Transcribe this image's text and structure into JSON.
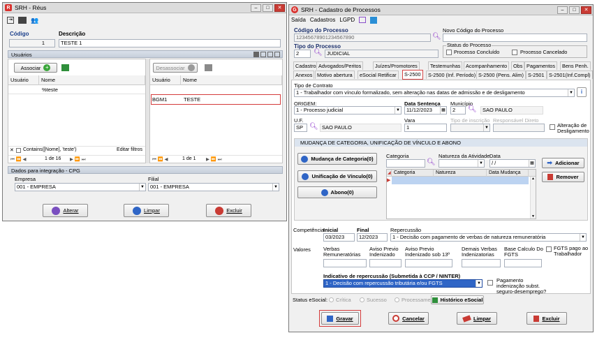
{
  "colors": {
    "accent_blue": "#2f65c6",
    "selected_row": "#3b7dd8",
    "highlight_red": "#d43b3b",
    "header_blue": "#dbe8f7"
  },
  "left": {
    "title": "SRH - Réus",
    "codigo_label": "Código",
    "descricao_label": "Descrição",
    "codigo_value": "1",
    "descricao_value": "TESTE 1",
    "usuarios_header": "Usuários",
    "associar": "Associar",
    "desassociar": "Desassociar",
    "col_usuario": "Usuário",
    "col_nome": "Nome",
    "filter_nome": "%teste",
    "right_row": {
      "usuario": "BGM1",
      "nome": "TESTE"
    },
    "filter_text": "Contains([Nome], 'teste')",
    "editar_filtros": "Editar filtros",
    "pager_left": "1 de 16",
    "pager_right": "1 de 1",
    "integracao_header": "Dados para integração - CPG",
    "empresa_label": "Empresa",
    "empresa_value": "001 - EMPRESA",
    "filial_label": "Filial",
    "filial_value": "001 - EMPRESA",
    "alterar": "Alterar",
    "limpar": "Limpar",
    "excluir": "Excluir"
  },
  "right": {
    "title": "SRH - Cadastro de Processos",
    "menu": [
      "Saída",
      "Cadastros",
      "LGPD"
    ],
    "codigo_processo_label": "Código do Processo",
    "codigo_processo_value": "12345678901234567890",
    "novo_codigo_label": "Novo Código do Processo",
    "tipo_processo_label": "Tipo do Processo",
    "tipo_code": "2",
    "tipo_desc": "JUDICIAL",
    "status_label": "Status do Processo",
    "status_opts": [
      "Processo Concluído",
      "Processo Cancelado"
    ],
    "tabs_row1": [
      "Cadastros",
      "Advogados/Peritos",
      "Juízes/Promotores",
      "Testemunhas",
      "Acompanhamento",
      "Obs",
      "Pagamentos",
      "Bens Penh."
    ],
    "tabs_row2": [
      "Anexos",
      "Motivo abertura",
      "eSocial Retificar",
      "S-2500",
      "S-2500 (Inf. Período)",
      "S-2500 (Pens. Alim)",
      "S-2501",
      "S-2501(Inf.Compl)"
    ],
    "tipo_contrato_label": "Tipo de Contrato",
    "tipo_contrato_value": "1 - Trabalhador com vínculo formalizado, sem alteração nas datas de admissão e de desligamento",
    "origem_label": "ORIGEM:",
    "origem_value": "1 - Processo judicial",
    "data_sentenca_label": "Data Sentença",
    "data_sentenca_value": "11/12/2023",
    "municipio_label": "Município",
    "municipio_code": "2",
    "municipio_name": "SAO PAULO",
    "uf_label": "U.F.",
    "uf_code": "SP",
    "uf_name": "SAO PAULO",
    "vara_label": "Vara",
    "vara_value": "1",
    "tipo_inscricao_label": "Tipo de inscrição",
    "responsavel_label": "Responsável Direto",
    "alteracao_label": "Alteração de Desligamento",
    "mudanca_header": "MUDANÇA DE CATEGORIA, UNIFICAÇÃO DE VÍNCULO E ABONO",
    "btn_mudanca": "Mudança de Categoria(0)",
    "btn_unificacao": "Unificação de Vínculo(0)",
    "btn_abono": "Abono(0)",
    "categoria_label": "Categoria",
    "natureza_label": "Natureza da Atividade",
    "data_label": "Data",
    "data_value": "/ /",
    "grid_cols": [
      "Categoria",
      "Natureza",
      "Data Mudança"
    ],
    "adicionar": "Adicionar",
    "remover": "Remover",
    "competencia_label": "Competência",
    "inicial_label": "Inicial",
    "inicial_value": "03/2023",
    "final_label": "Final",
    "final_value": "12/2023",
    "repercussao_label": "Repercussão",
    "repercussao_value": "1 - Decisão com pagamento de verbas de natureza remuneratória",
    "valores_label": "Valores",
    "verbas_label": "Verbas Remuneratórias",
    "aviso_label": "Aviso Previo Indenizado",
    "aviso13_label": "Aviso Previo Indenizado sob 13º",
    "demais_label": "Demais Verbas Indenizatorias",
    "base_label": "Base Calculo Do FGTS",
    "fgts_label": "FGTS pago ao Trabalhador",
    "indicativo_label": "Indicativo de repercussão (Submetida à CCP / NINTER)",
    "indicativo_value": "1 - Decisão com repercussão tributária e/ou FGTS",
    "pagamento_label": "Pagamento indenização subst. seguro-desemprego?",
    "status_esocial_label": "Status eSocial:",
    "status_critica": "Crítica",
    "status_sucesso": "Sucesso",
    "status_processamento": "Processamento",
    "historico": "Histórico eSocial",
    "gravar": "Gravar",
    "cancelar": "Cancelar",
    "limpar": "Limpar",
    "excluir": "Excluir"
  }
}
